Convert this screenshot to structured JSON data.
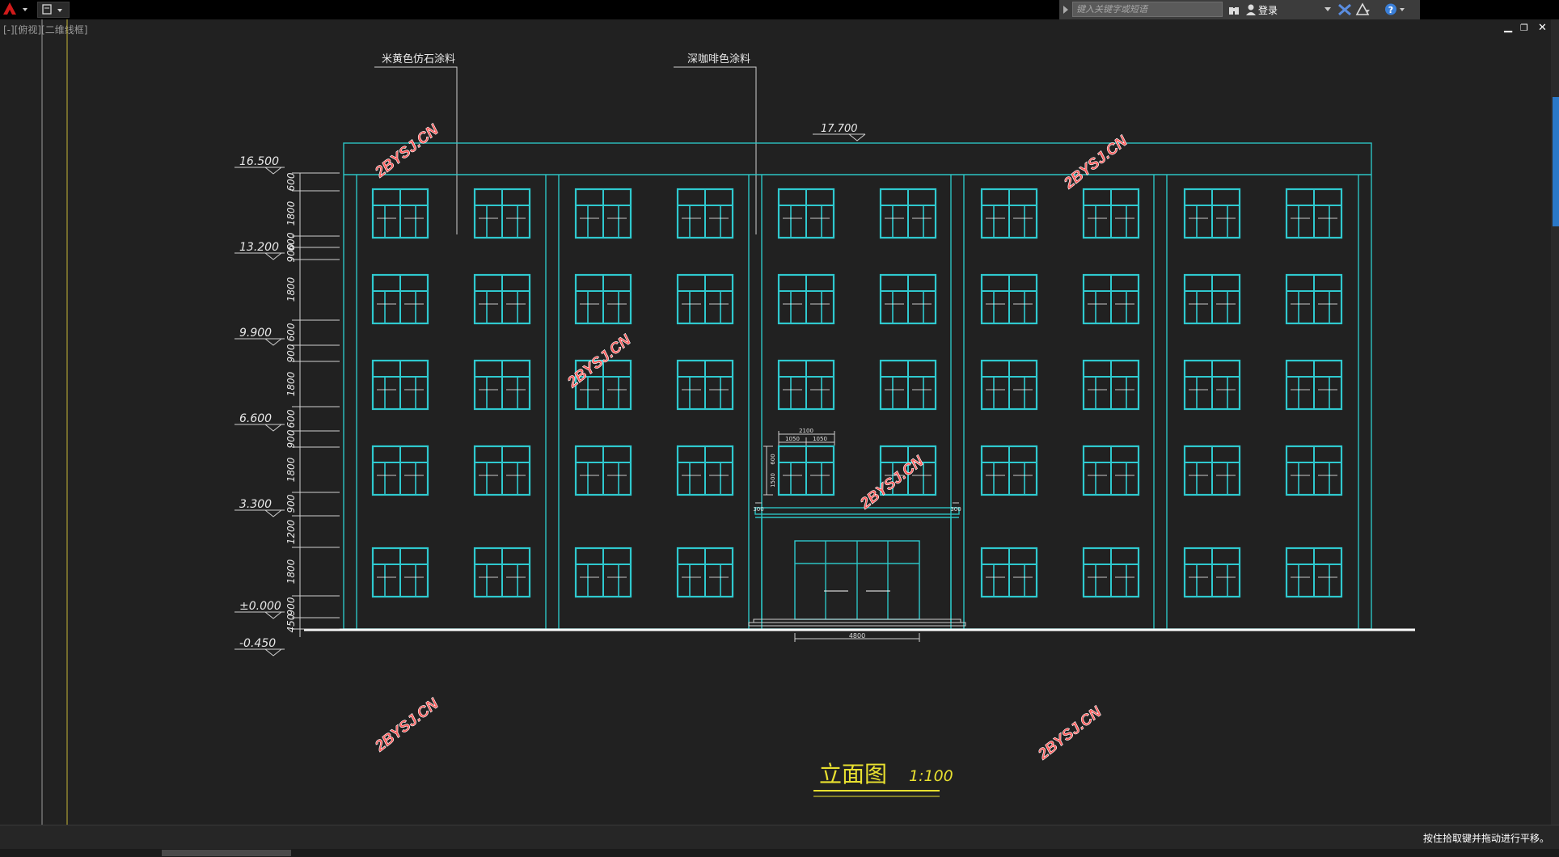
{
  "search": {
    "placeholder": "键入关键字或短语"
  },
  "login_label": "登录",
  "viewport_label": "[-][俯视][二维线框]",
  "notes": {
    "left_material": "米黄色仿石涂料",
    "right_material": "深咖啡色涂料"
  },
  "top_elevation": "17.700",
  "elevations": [
    "16.500",
    "13.200",
    "9.900",
    "6.600",
    "3.300",
    "±0.000",
    "-0.450"
  ],
  "dims": {
    "labels": [
      "600",
      "1800",
      "600",
      "900",
      "1800",
      "600",
      "900",
      "1800",
      "600",
      "900",
      "1800",
      "900",
      "1200",
      "1800",
      "900",
      "450"
    ],
    "window_w": "2100",
    "window_parts": [
      "1050",
      "1050"
    ],
    "window_h": [
      "600",
      "1500"
    ],
    "canopy_a": "300",
    "canopy_b": "300",
    "door_w": "4800"
  },
  "title": {
    "text": "立面图",
    "scale": "1:100"
  },
  "watermark": "2BYSJ.CN",
  "status_text": "按住拾取键并拖动进行平移。",
  "colors": {
    "frame": "#2cc4c4",
    "window": "#2fc9cf",
    "title": "#e8e030",
    "watermark": "#ff5a5a",
    "grid_line": "#c8b638"
  }
}
